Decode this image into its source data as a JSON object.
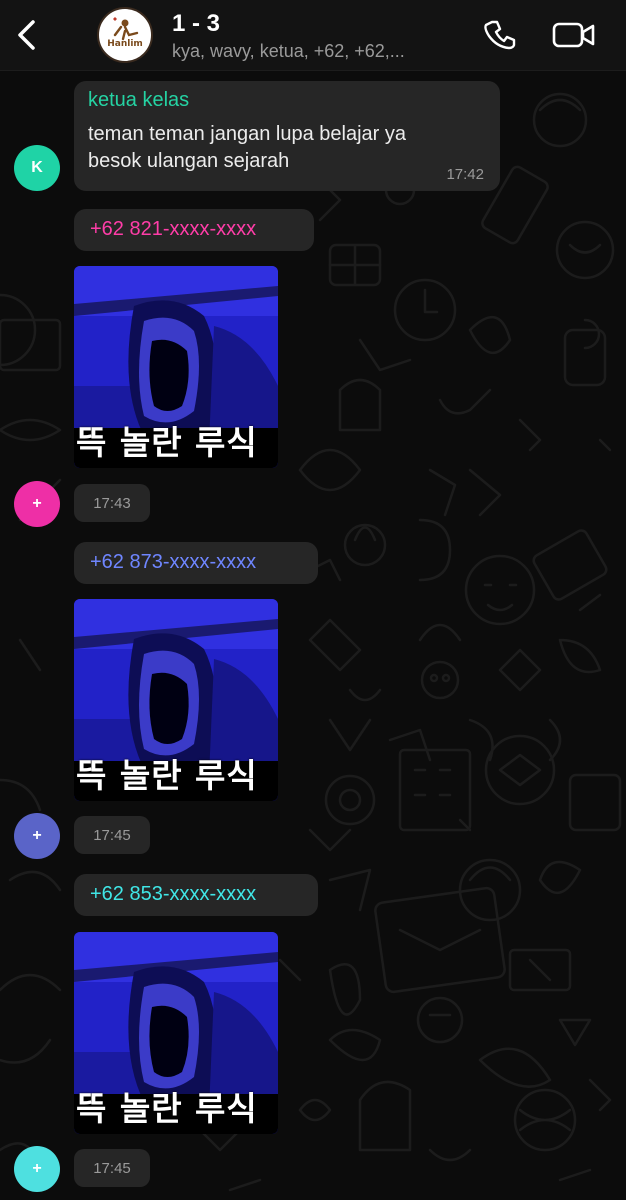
{
  "header": {
    "back_icon": "chevron-left-icon",
    "group_avatar_label": "Hanlim",
    "title": "1 - 3",
    "subtitle": "kya, wavy, ketua, +62, +62,...",
    "call_icon": "phone-icon",
    "video_icon": "video-camera-icon"
  },
  "messages": [
    {
      "sender": "ketua kelas",
      "sender_color": "#25d3a3",
      "avatar_letter": "K",
      "avatar_color": "#1fd3a6",
      "text_line1": "teman teman jangan lupa belajar ya",
      "text_line2": "besok ulangan sejarah",
      "time": "17:42"
    },
    {
      "sender": "+62 821-xxxx-xxxx",
      "sender_color": "#ff3da8",
      "avatar_letter": "+",
      "avatar_color": "#ee2fa6",
      "image_caption": "뜩 놀란 루식",
      "time": "17:43"
    },
    {
      "sender": "+62 873-xxxx-xxxx",
      "sender_color": "#6f86ff",
      "avatar_letter": "+",
      "avatar_color": "#5a64c8",
      "image_caption": "뜩 놀란 루식",
      "time": "17:45"
    },
    {
      "sender": "+62 853-xxxx-xxxx",
      "sender_color": "#40e6e6",
      "avatar_letter": "+",
      "avatar_color": "#4ee0e0",
      "image_caption": "뜩 놀란 루식",
      "time": "17:45"
    }
  ]
}
